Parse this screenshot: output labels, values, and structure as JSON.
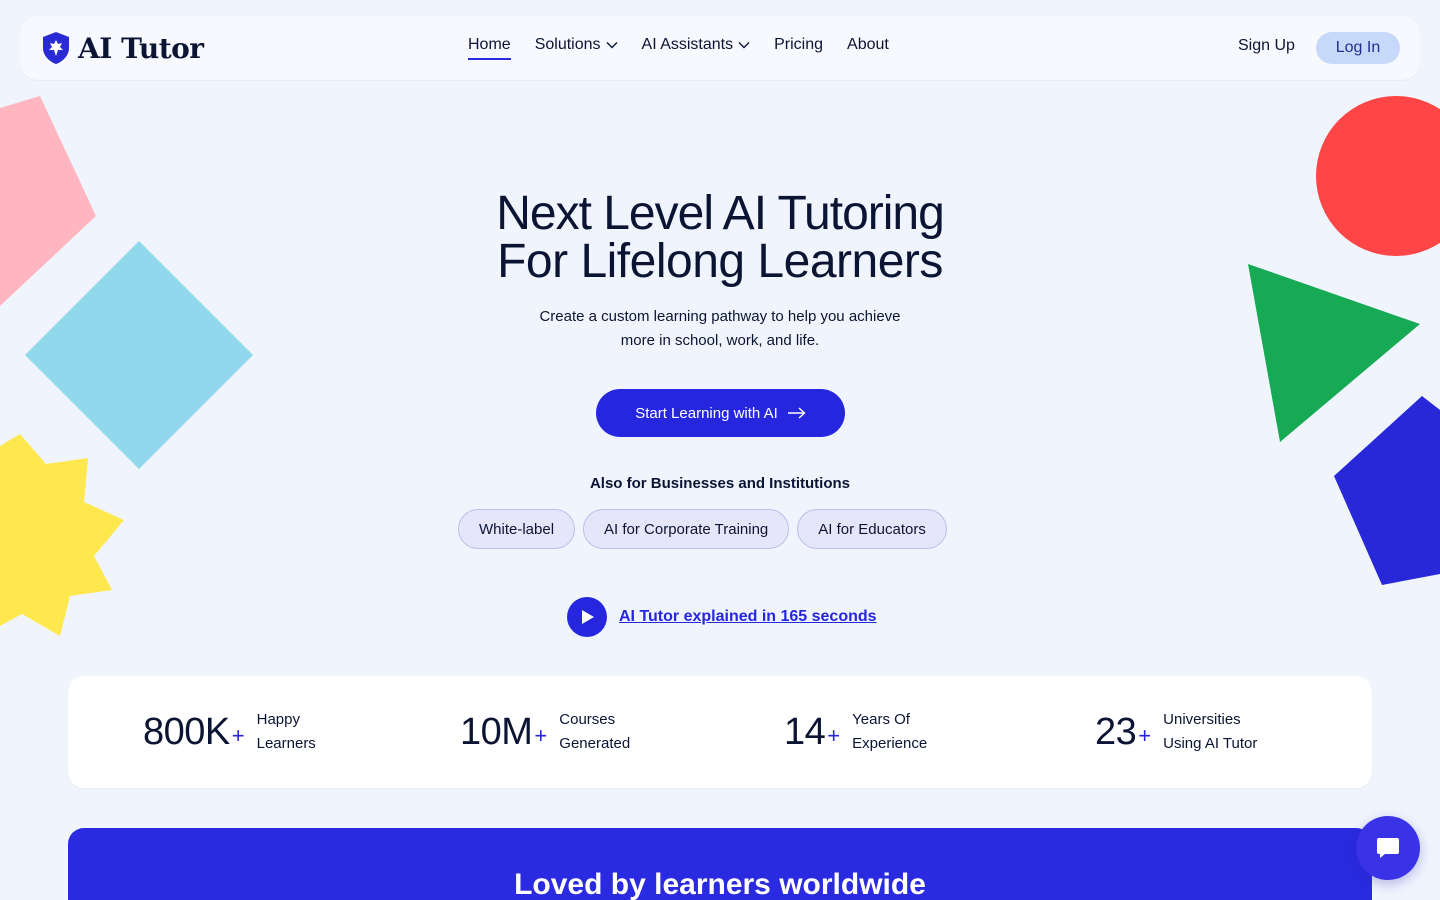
{
  "header": {
    "logo_text": "AI Tutor",
    "logo_icon": "shield-logo-icon",
    "nav": [
      {
        "label": "Home",
        "active": true
      },
      {
        "label": "Solutions",
        "dropdown": true
      },
      {
        "label": "AI Assistants",
        "dropdown": true
      },
      {
        "label": "Pricing"
      },
      {
        "label": "About"
      }
    ],
    "signup_label": "Sign Up",
    "login_label": "Log In"
  },
  "hero": {
    "title_line1": "Next Level AI Tutoring",
    "title_line2": "For Lifelong Learners",
    "subtitle_line1": "Create a custom learning pathway to help you achieve",
    "subtitle_line2": "more in school, work, and life.",
    "cta_label": "Start Learning with AI",
    "also_label": "Also for Businesses and Institutions",
    "pills": [
      "White-label",
      "AI for Corporate Training",
      "AI for Educators"
    ],
    "video_label": "AI Tutor explained in 165 seconds"
  },
  "stats": [
    {
      "value": "800K",
      "plus": "+",
      "label_line1": "Happy",
      "label_line2": "Learners"
    },
    {
      "value": "10M",
      "plus": "+",
      "label_line1": "Courses",
      "label_line2": "Generated"
    },
    {
      "value": "14",
      "plus": "+",
      "label_line1": "Years Of",
      "label_line2": "Experience"
    },
    {
      "value": "23",
      "plus": "+",
      "label_line1": "Universities",
      "label_line2": "Using AI Tutor"
    }
  ],
  "banner": {
    "title": "Loved by learners worldwide"
  },
  "colors": {
    "background": "#f0f5fd",
    "primary": "#2626df",
    "login_bg": "#c7d9fb",
    "pill_bg": "#e6e6fb",
    "shape_pink": "#ffb6c1",
    "shape_blue": "#92d8ec",
    "shape_yellow": "#ffe84d",
    "shape_red": "#ff4545",
    "shape_green": "#16aa55",
    "shape_indigo": "#2828d8"
  }
}
